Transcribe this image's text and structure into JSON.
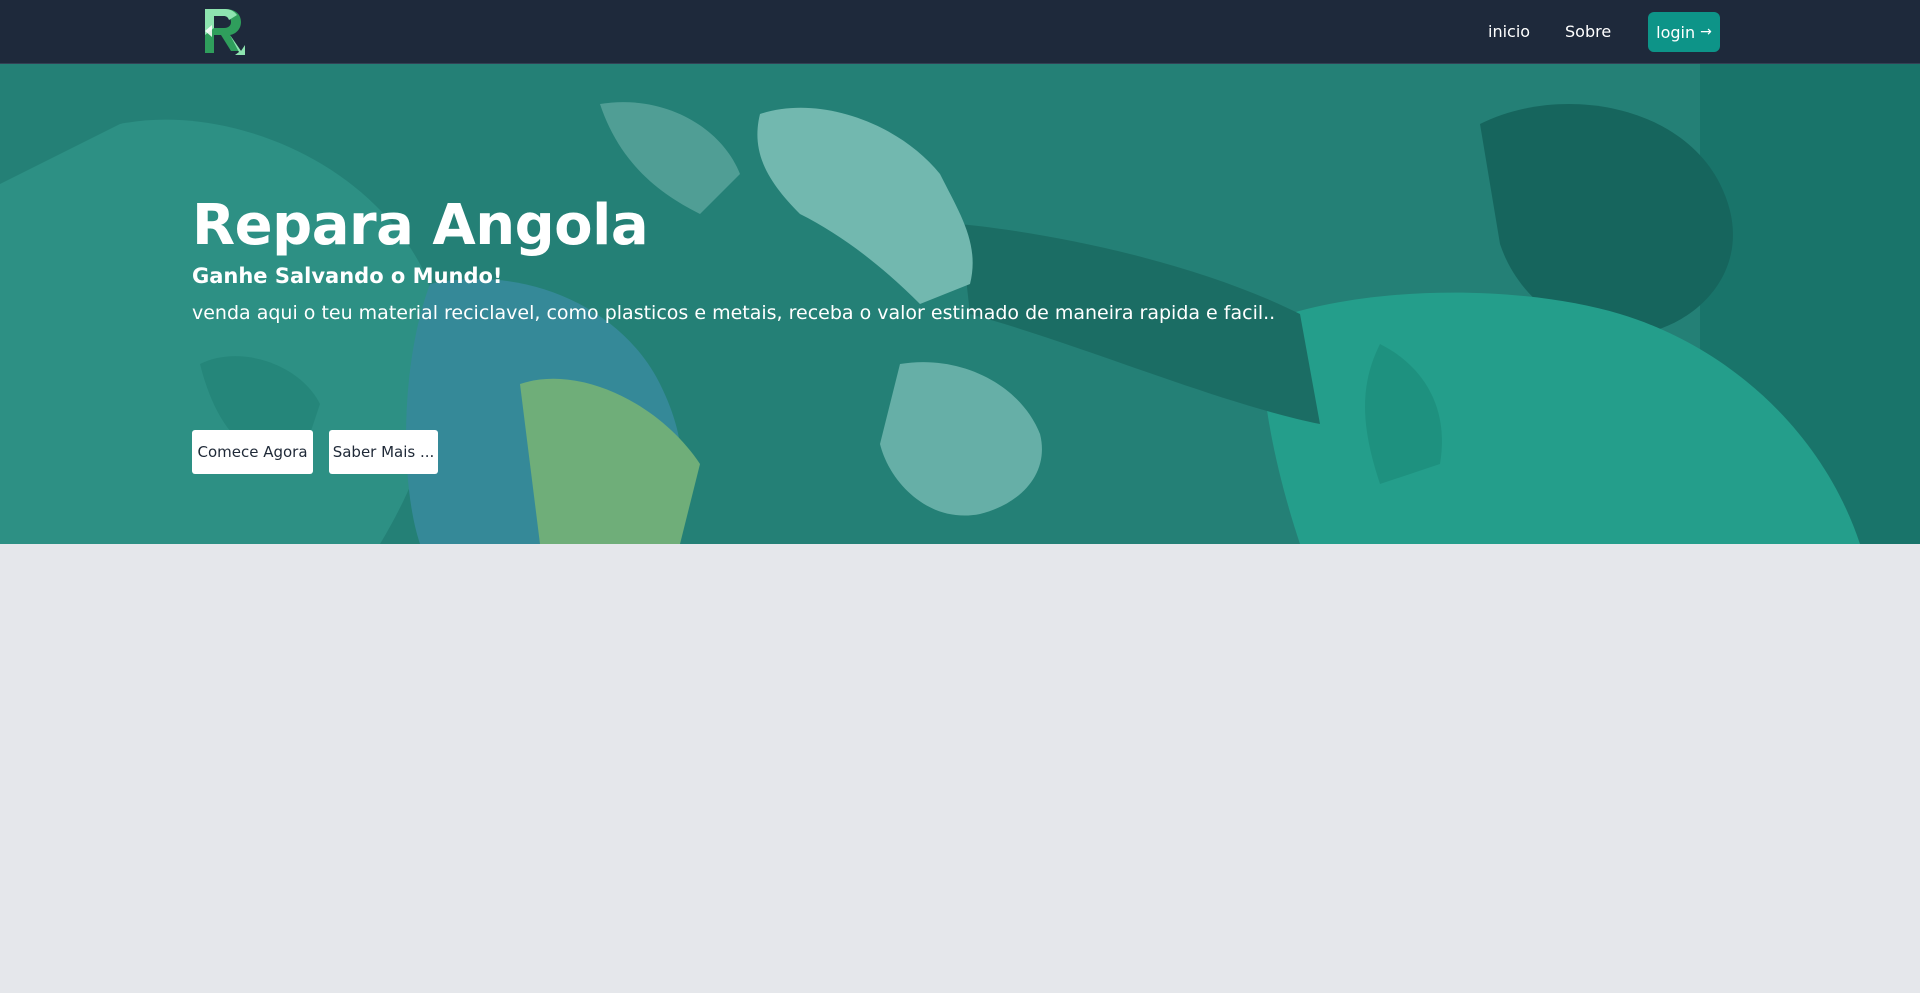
{
  "brand": {
    "logo_icon": "recycle-r-logo-icon",
    "colors": {
      "logo_light": "#8ee4b0",
      "logo_dark": "#2f9e5c"
    }
  },
  "nav": {
    "items": [
      {
        "label": "inicio"
      },
      {
        "label": "Sobre"
      }
    ],
    "login_label": "login",
    "login_icon": "arrow-right-icon",
    "login_arrow": "→"
  },
  "hero": {
    "title": "Repara Angola",
    "subtitle": "Ganhe Salvando o Mundo!",
    "description": "venda aqui o teu material reciclavel, como plasticos e metais, receba o valor estimado de maneira rapida e facil..",
    "buttons": [
      {
        "label": "Comece Agora"
      },
      {
        "label": "Saber Mais ..."
      }
    ],
    "background_icon": "recycling-worker-photo"
  },
  "colors": {
    "navbar": "#1e293b",
    "accent": "#0d9488",
    "hero_overlay": "#0d9488",
    "page_background": "#e5e7eb"
  }
}
